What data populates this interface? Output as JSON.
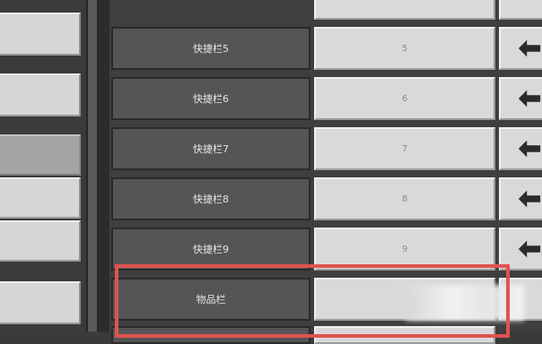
{
  "rows": [
    {
      "label": "快捷栏5",
      "key": "5"
    },
    {
      "label": "快捷栏6",
      "key": "6"
    },
    {
      "label": "快捷栏7",
      "key": "7"
    },
    {
      "label": "快捷栏8",
      "key": "8"
    },
    {
      "label": "快捷栏9",
      "key": "9"
    },
    {
      "label": "物品栏",
      "key": ""
    }
  ],
  "icons": {
    "reset": "undo-arrow-icon"
  },
  "colors": {
    "highlight": "#e0524f"
  }
}
